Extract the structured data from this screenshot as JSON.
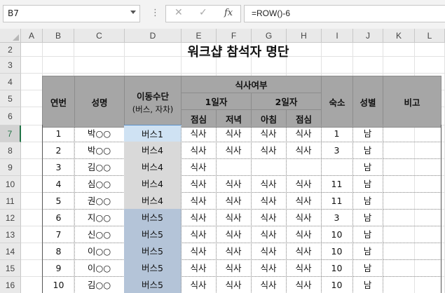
{
  "formula_bar": {
    "name_box": "B7",
    "more_icon": "⋮",
    "cancel_icon": "✕",
    "enter_icon": "✓",
    "fx_label": "fx",
    "formula": "=ROW()-6"
  },
  "columns": [
    "A",
    "B",
    "C",
    "D",
    "E",
    "F",
    "G",
    "H",
    "I",
    "J",
    "K",
    "L"
  ],
  "rows": [
    "2",
    "3",
    "4",
    "5",
    "6",
    "7",
    "8",
    "9",
    "10",
    "11",
    "12",
    "13",
    "14",
    "15",
    "16"
  ],
  "title": "워크샵 참석자 명단",
  "headers": {
    "no": "연번",
    "name": "성명",
    "transport": "이동수단",
    "transport_sub": "(버스, 자차)",
    "meals": "식사여부",
    "day1": "1일자",
    "day2": "2일자",
    "lunch": "점심",
    "dinner": "저녁",
    "breakfast": "아침",
    "lunch2": "점심",
    "lodging": "숙소",
    "gender": "성별",
    "note": "비고"
  },
  "records": [
    {
      "no": "1",
      "name": "박○○",
      "bus": "버스1",
      "m1": "식사",
      "m2": "식사",
      "m3": "식사",
      "m4": "식사",
      "lodge": "1",
      "gender": "남",
      "note": ""
    },
    {
      "no": "2",
      "name": "박○○",
      "bus": "버스4",
      "m1": "식사",
      "m2": "식사",
      "m3": "식사",
      "m4": "식사",
      "lodge": "3",
      "gender": "남",
      "note": ""
    },
    {
      "no": "3",
      "name": "김○○",
      "bus": "버스4",
      "m1": "식사",
      "m2": "",
      "m3": "",
      "m4": "",
      "lodge": "",
      "gender": "남",
      "note": ""
    },
    {
      "no": "4",
      "name": "심○○",
      "bus": "버스4",
      "m1": "식사",
      "m2": "식사",
      "m3": "식사",
      "m4": "식사",
      "lodge": "11",
      "gender": "남",
      "note": ""
    },
    {
      "no": "5",
      "name": "권○○",
      "bus": "버스4",
      "m1": "식사",
      "m2": "식사",
      "m3": "식사",
      "m4": "식사",
      "lodge": "11",
      "gender": "남",
      "note": ""
    },
    {
      "no": "6",
      "name": "지○○",
      "bus": "버스5",
      "m1": "식사",
      "m2": "식사",
      "m3": "식사",
      "m4": "식사",
      "lodge": "3",
      "gender": "남",
      "note": ""
    },
    {
      "no": "7",
      "name": "신○○",
      "bus": "버스5",
      "m1": "식사",
      "m2": "식사",
      "m3": "식사",
      "m4": "식사",
      "lodge": "10",
      "gender": "남",
      "note": ""
    },
    {
      "no": "8",
      "name": "이○○",
      "bus": "버스5",
      "m1": "식사",
      "m2": "식사",
      "m3": "식사",
      "m4": "식사",
      "lodge": "10",
      "gender": "남",
      "note": ""
    },
    {
      "no": "9",
      "name": "이○○",
      "bus": "버스5",
      "m1": "식사",
      "m2": "식사",
      "m3": "식사",
      "m4": "식사",
      "lodge": "10",
      "gender": "남",
      "note": ""
    },
    {
      "no": "10",
      "name": "김○○",
      "bus": "버스5",
      "m1": "식사",
      "m2": "식사",
      "m3": "식사",
      "m4": "식사",
      "lodge": "10",
      "gender": "남",
      "note": ""
    }
  ],
  "colors": {
    "header_fill": "#a6a6a6",
    "bus1_fill": "#cfe2f3",
    "bus4_fill": "#d9d9d9",
    "bus5_fill": "#b4c4d8",
    "selected_row_accent": "#217346"
  }
}
